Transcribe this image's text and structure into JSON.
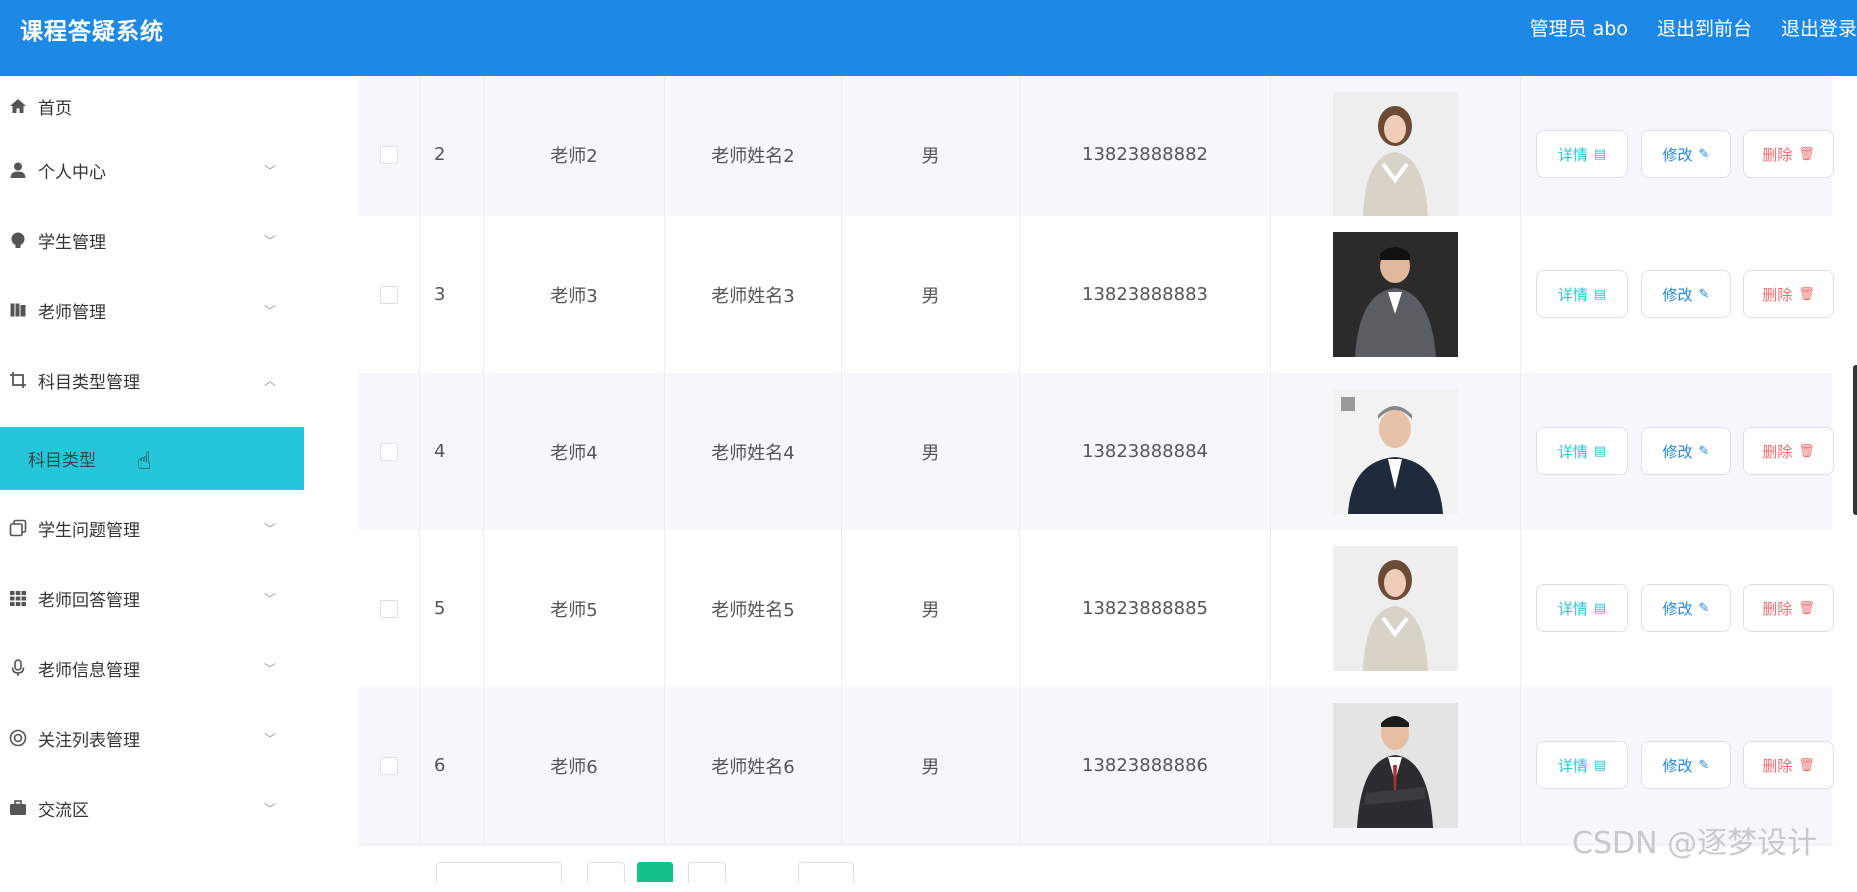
{
  "header": {
    "title": "课程答疑系统",
    "admin_label": "管理员 abo",
    "front_label": "退出到前台",
    "logout_label": "退出登录"
  },
  "sidebar": {
    "items": [
      {
        "label": "首页",
        "icon": "home-icon"
      },
      {
        "label": "个人中心",
        "icon": "user-icon"
      },
      {
        "label": "学生管理",
        "icon": "bulb-icon"
      },
      {
        "label": "老师管理",
        "icon": "book-icon"
      },
      {
        "label": "科目类型管理",
        "icon": "crop-icon"
      },
      {
        "label": "学生问题管理",
        "icon": "copy-icon"
      },
      {
        "label": "老师回答管理",
        "icon": "grid-icon"
      },
      {
        "label": "老师信息管理",
        "icon": "mic-icon"
      },
      {
        "label": "关注列表管理",
        "icon": "lifebuoy-icon"
      },
      {
        "label": "交流区",
        "icon": "briefcase-icon"
      }
    ],
    "sub_item": {
      "label": "科目类型"
    }
  },
  "table": {
    "rows": [
      {
        "index": "2",
        "account": "老师2",
        "name": "老师姓名2",
        "gender": "男",
        "phone": "13823888882",
        "photo": "female-teacher-photo"
      },
      {
        "index": "3",
        "account": "老师3",
        "name": "老师姓名3",
        "gender": "男",
        "phone": "13823888883",
        "photo": "male-teacher-seated-photo"
      },
      {
        "index": "4",
        "account": "老师4",
        "name": "老师姓名4",
        "gender": "男",
        "phone": "13823888884",
        "photo": "male-teacher-suit-photo"
      },
      {
        "index": "5",
        "account": "老师5",
        "name": "老师姓名5",
        "gender": "男",
        "phone": "13823888885",
        "photo": "female-teacher-photo"
      },
      {
        "index": "6",
        "account": "老师6",
        "name": "老师姓名6",
        "gender": "男",
        "phone": "13823888886",
        "photo": "male-teacher-arms-crossed-photo"
      }
    ],
    "actions": {
      "detail": "详情",
      "edit": "修改",
      "delete": "删除"
    }
  },
  "colors": {
    "header_bg": "#1e88e5",
    "active_menu_bg": "#26c6da",
    "detail_color": "#26c6da",
    "edit_color": "#1e88e5",
    "delete_color": "#f56c6c",
    "pager_active": "#13c18a"
  },
  "watermark": "CSDN @逐梦设计"
}
